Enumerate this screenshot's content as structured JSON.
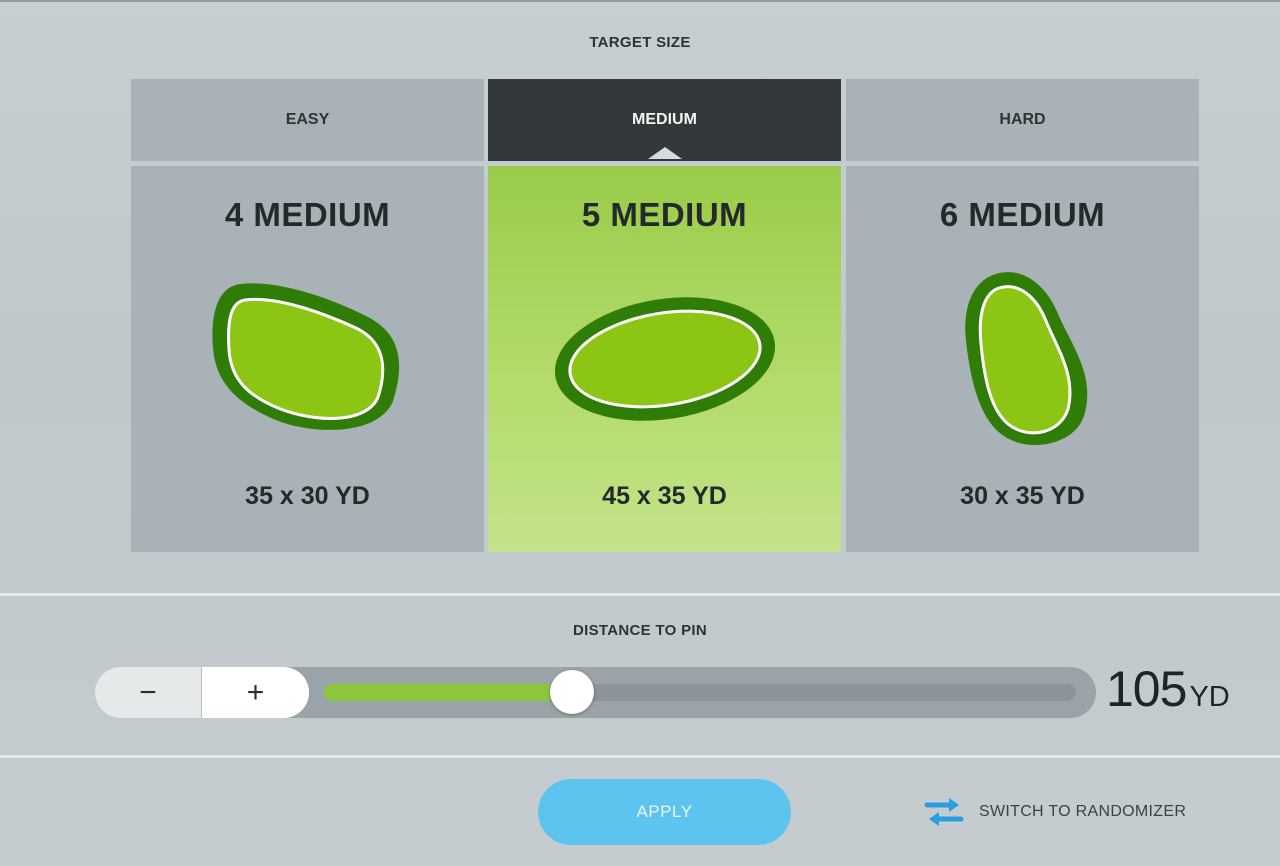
{
  "target_size": {
    "title": "TARGET SIZE",
    "tabs": [
      {
        "label": "EASY",
        "active": false
      },
      {
        "label": "MEDIUM",
        "active": true
      },
      {
        "label": "HARD",
        "active": false
      }
    ],
    "cards": [
      {
        "title": "4 MEDIUM",
        "size": "35 x 30 YD",
        "selected": false,
        "shape": "kidney-shaped-green"
      },
      {
        "title": "5 MEDIUM",
        "size": "45 x 35 YD",
        "selected": true,
        "shape": "oval-green"
      },
      {
        "title": "6 MEDIUM",
        "size": "30 x 35 YD",
        "selected": false,
        "shape": "pear-shaped-green"
      }
    ]
  },
  "distance_to_pin": {
    "title": "DISTANCE TO PIN",
    "minus_label": "−",
    "plus_label": "+",
    "value": "105",
    "unit": "YD",
    "slider_fraction": 0.33
  },
  "footer": {
    "apply_label": "APPLY",
    "randomizer_label": "SWITCH TO RANDOMIZER",
    "randomizer_icon": "swap-arrows-icon"
  },
  "colors": {
    "accent_green": "#8cc63f",
    "selected_card": "#b3db6b",
    "green_outline": "#2f7d06",
    "green_fill": "#8cc514",
    "tab_active": "#33383b",
    "apply_button": "#5cc4ee",
    "swap_icon": "#2a9de0"
  }
}
